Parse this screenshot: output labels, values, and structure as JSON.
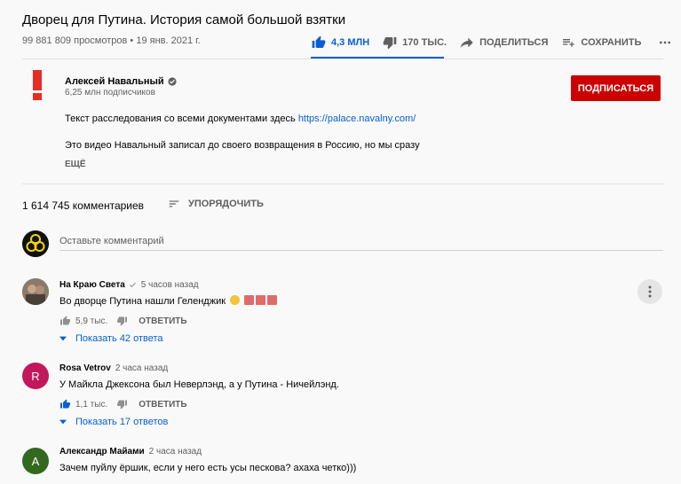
{
  "video": {
    "title": "Дворец для Путина. История самой большой взятки",
    "views": "99 881 809 просмотров",
    "date": "• 19 янв. 2021 г."
  },
  "actions": {
    "likes": "4,3 МЛН",
    "dislikes": "170 ТЫС.",
    "share": "ПОДЕЛИТЬСЯ",
    "save": "СОХРАНИТЬ",
    "accent": "#065fd4"
  },
  "channel": {
    "name": "Алексей Навальный",
    "subscribers": "6,25 млн подписчиков",
    "subscribe_label": "ПОДПИСАТЬСЯ",
    "subscribe_color": "#cc0000",
    "logo_color": "#e52d27"
  },
  "description": {
    "line1": "Текст расследования со всеми документами здесь ",
    "link": "https://palace.navalny.com/",
    "line2": "Это видео Навальный записал до своего возвращения в Россию, но мы сразу",
    "more": "ЕЩЁ"
  },
  "comments_header": {
    "count": "1 614 745 комментариев",
    "sort_label": "УПОРЯДОЧИТЬ",
    "add_placeholder": "Оставьте комментарий"
  },
  "comments": [
    {
      "author": "На Краю Света",
      "time": "5 часов назад",
      "text": "Во дворце Путина нашли Геленджик",
      "likes": "5,9 тыс.",
      "reply": "ОТВЕТИТЬ",
      "replies": "Показать 42 ответа",
      "avatar_icon": "photo-avatar"
    },
    {
      "author": "Rosa Vetrov",
      "time": "2 часа назад",
      "text": "У Майкла Джексона был Неверлэнд, а у Путина - Ничейлэнд.",
      "likes": "1,1 тыс.",
      "reply": "ОТВЕТИТЬ",
      "replies": "Показать 17 ответов",
      "avatar_letter": "R",
      "avatar_color": "#c2185b"
    },
    {
      "author": "Александр Майами",
      "time": "2 часа назад",
      "text": "Зачем пуйлу ёршик, если у него есть усы пескова? ахаха четко)))",
      "avatar_letter": "A",
      "avatar_color": "#33691e"
    }
  ]
}
